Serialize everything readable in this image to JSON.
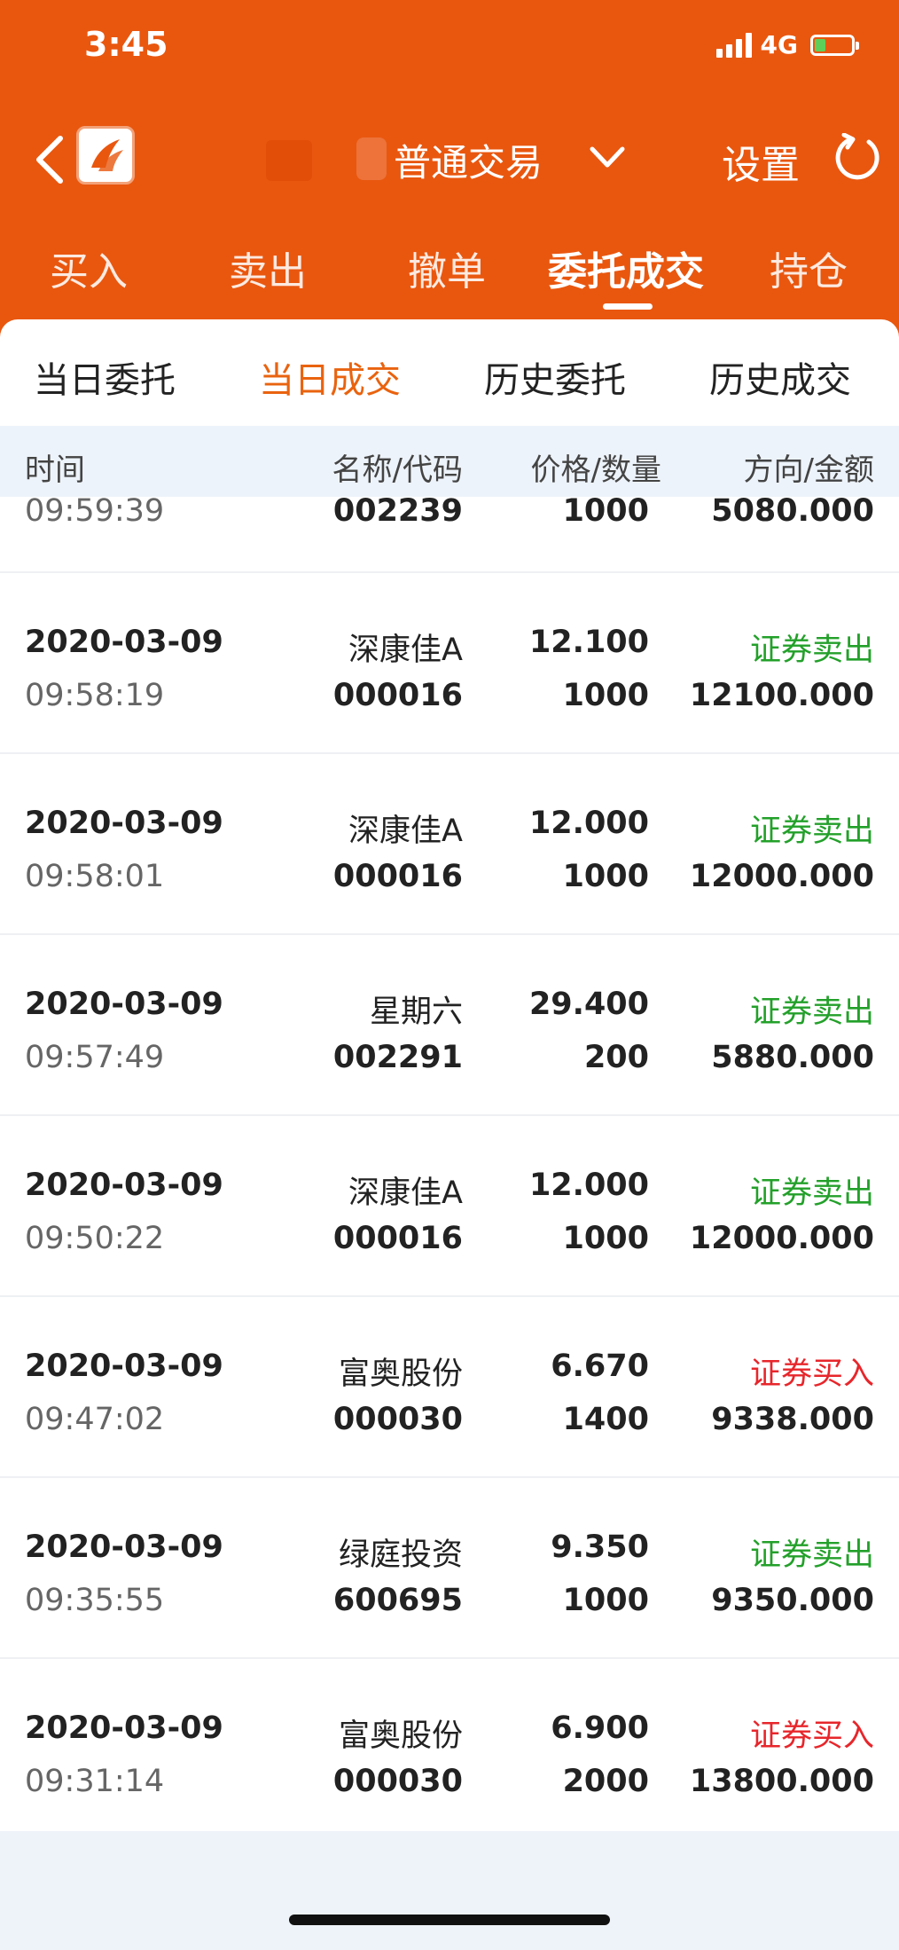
{
  "status_bar": {
    "time": "3:45",
    "network": "4G"
  },
  "nav": {
    "title": "普通交易",
    "settings_label": "设置"
  },
  "tabs": [
    {
      "label": "买入",
      "active": false
    },
    {
      "label": "卖出",
      "active": false
    },
    {
      "label": "撤单",
      "active": false
    },
    {
      "label": "委托成交",
      "active": true
    },
    {
      "label": "持仓",
      "active": false
    }
  ],
  "subtabs": [
    {
      "label": "当日委托",
      "active": false
    },
    {
      "label": "当日成交",
      "active": true
    },
    {
      "label": "历史委托",
      "active": false
    },
    {
      "label": "历史成交",
      "active": false
    }
  ],
  "columns": {
    "time": "时间",
    "name_code": "名称/代码",
    "price_qty": "价格/数量",
    "dir_amount": "方向/金额"
  },
  "partial_row": {
    "time": "09:59:39",
    "code": "002239",
    "qty": "1000",
    "amount": "5080.000"
  },
  "rows": [
    {
      "date": "2020-03-09",
      "time": "09:58:19",
      "name": "深康佳A",
      "code": "000016",
      "price": "12.100",
      "qty": "1000",
      "direction": "证券卖出",
      "amount": "12100.000"
    },
    {
      "date": "2020-03-09",
      "time": "09:58:01",
      "name": "深康佳A",
      "code": "000016",
      "price": "12.000",
      "qty": "1000",
      "direction": "证券卖出",
      "amount": "12000.000"
    },
    {
      "date": "2020-03-09",
      "time": "09:57:49",
      "name": "星期六",
      "code": "002291",
      "price": "29.400",
      "qty": "200",
      "direction": "证券卖出",
      "amount": "5880.000"
    },
    {
      "date": "2020-03-09",
      "time": "09:50:22",
      "name": "深康佳A",
      "code": "000016",
      "price": "12.000",
      "qty": "1000",
      "direction": "证券卖出",
      "amount": "12000.000"
    },
    {
      "date": "2020-03-09",
      "time": "09:47:02",
      "name": "富奥股份",
      "code": "000030",
      "price": "6.670",
      "qty": "1400",
      "direction": "证券买入",
      "amount": "9338.000"
    },
    {
      "date": "2020-03-09",
      "time": "09:35:55",
      "name": "绿庭投资",
      "code": "600695",
      "price": "9.350",
      "qty": "1000",
      "direction": "证券卖出",
      "amount": "9350.000"
    },
    {
      "date": "2020-03-09",
      "time": "09:31:14",
      "name": "富奥股份",
      "code": "000030",
      "price": "6.900",
      "qty": "2000",
      "direction": "证券买入",
      "amount": "13800.000"
    }
  ],
  "colors": {
    "header": "#e9570f",
    "accent": "#e9630f",
    "sell": "#23a02a",
    "buy": "#e7262b"
  }
}
